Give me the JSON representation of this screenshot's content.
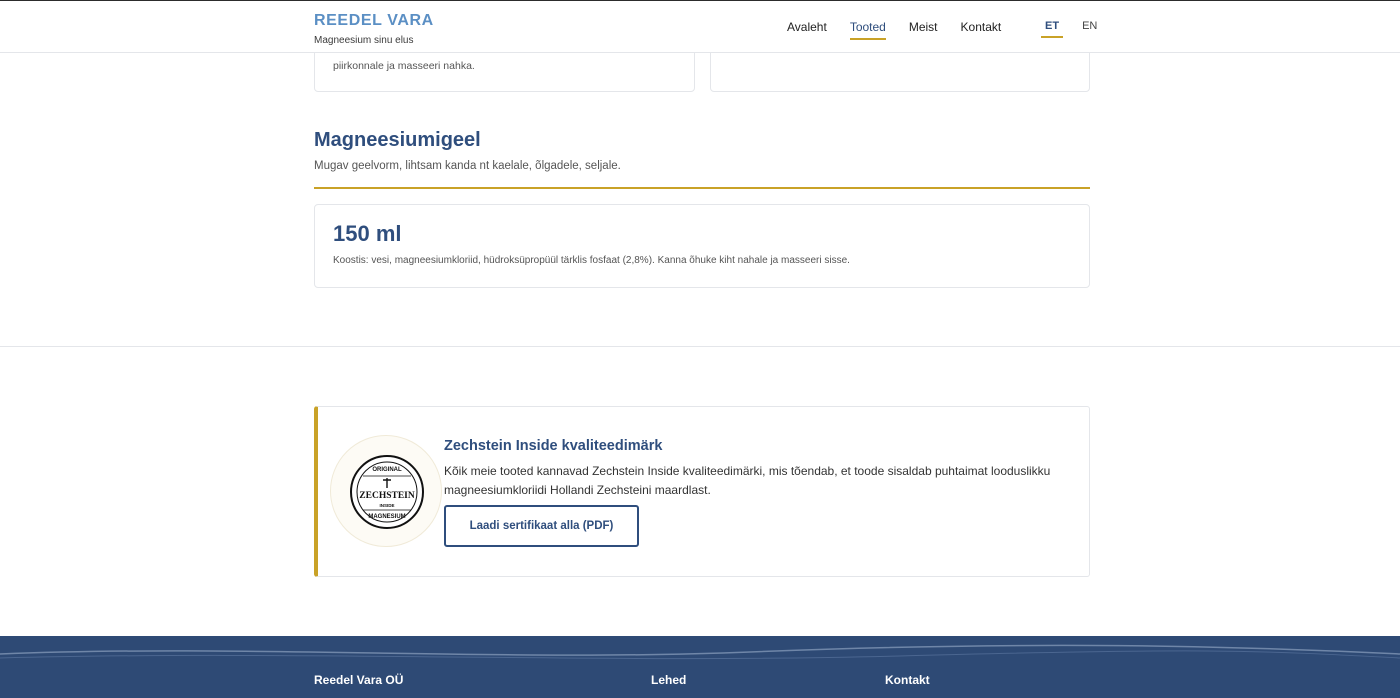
{
  "header": {
    "brand_name": "REEDEL VARA",
    "brand_tagline": "Magneesium sinu elus",
    "nav": [
      {
        "label": "Avaleht",
        "active": false
      },
      {
        "label": "Tooted",
        "active": true
      },
      {
        "label": "Meist",
        "active": false
      },
      {
        "label": "Kontakt",
        "active": false
      }
    ],
    "languages": [
      {
        "label": "ET",
        "active": true
      },
      {
        "label": "EN",
        "active": false
      }
    ]
  },
  "top_cards": {
    "left_text": "piirkonnale ja masseeri nahka.",
    "right_text": ""
  },
  "gel_section": {
    "title": "Magneesiumigeel",
    "description": "Mugav geelvorm, lihtsam kanda nt kaelale, õlgadele, seljale.",
    "product": {
      "size": "150 ml",
      "composition": "Koostis: vesi, magneesiumkloriid, hüdroksüpropüül tärklis fosfaat (2,8%). Kanna õhuke kiht nahale ja masseeri sisse."
    }
  },
  "quality": {
    "title": "Zechstein Inside kvaliteedimärk",
    "text": "Kõik meie tooted kannavad Zechstein Inside kvaliteedimärki, mis tõendab, et toode sisaldab puhtaimat looduslikku magneesiumkloriidi Hollandi Zechsteini maardlast.",
    "button_label": "Laadi sertifikaat alla (PDF)",
    "seal": {
      "top": "ORIGINAL",
      "middle": "ZECHSTEIN",
      "sub": "INSIDE",
      "bottom": "MAGNESIUM"
    }
  },
  "footer": {
    "col1": "Reedel Vara OÜ",
    "col2": "Lehed",
    "col3": "Kontakt"
  },
  "colors": {
    "brand_blue": "#2f4e7d",
    "brand_light_blue": "#5b8fc4",
    "accent_gold": "#c9a227",
    "footer_bg": "#2e4a75"
  }
}
